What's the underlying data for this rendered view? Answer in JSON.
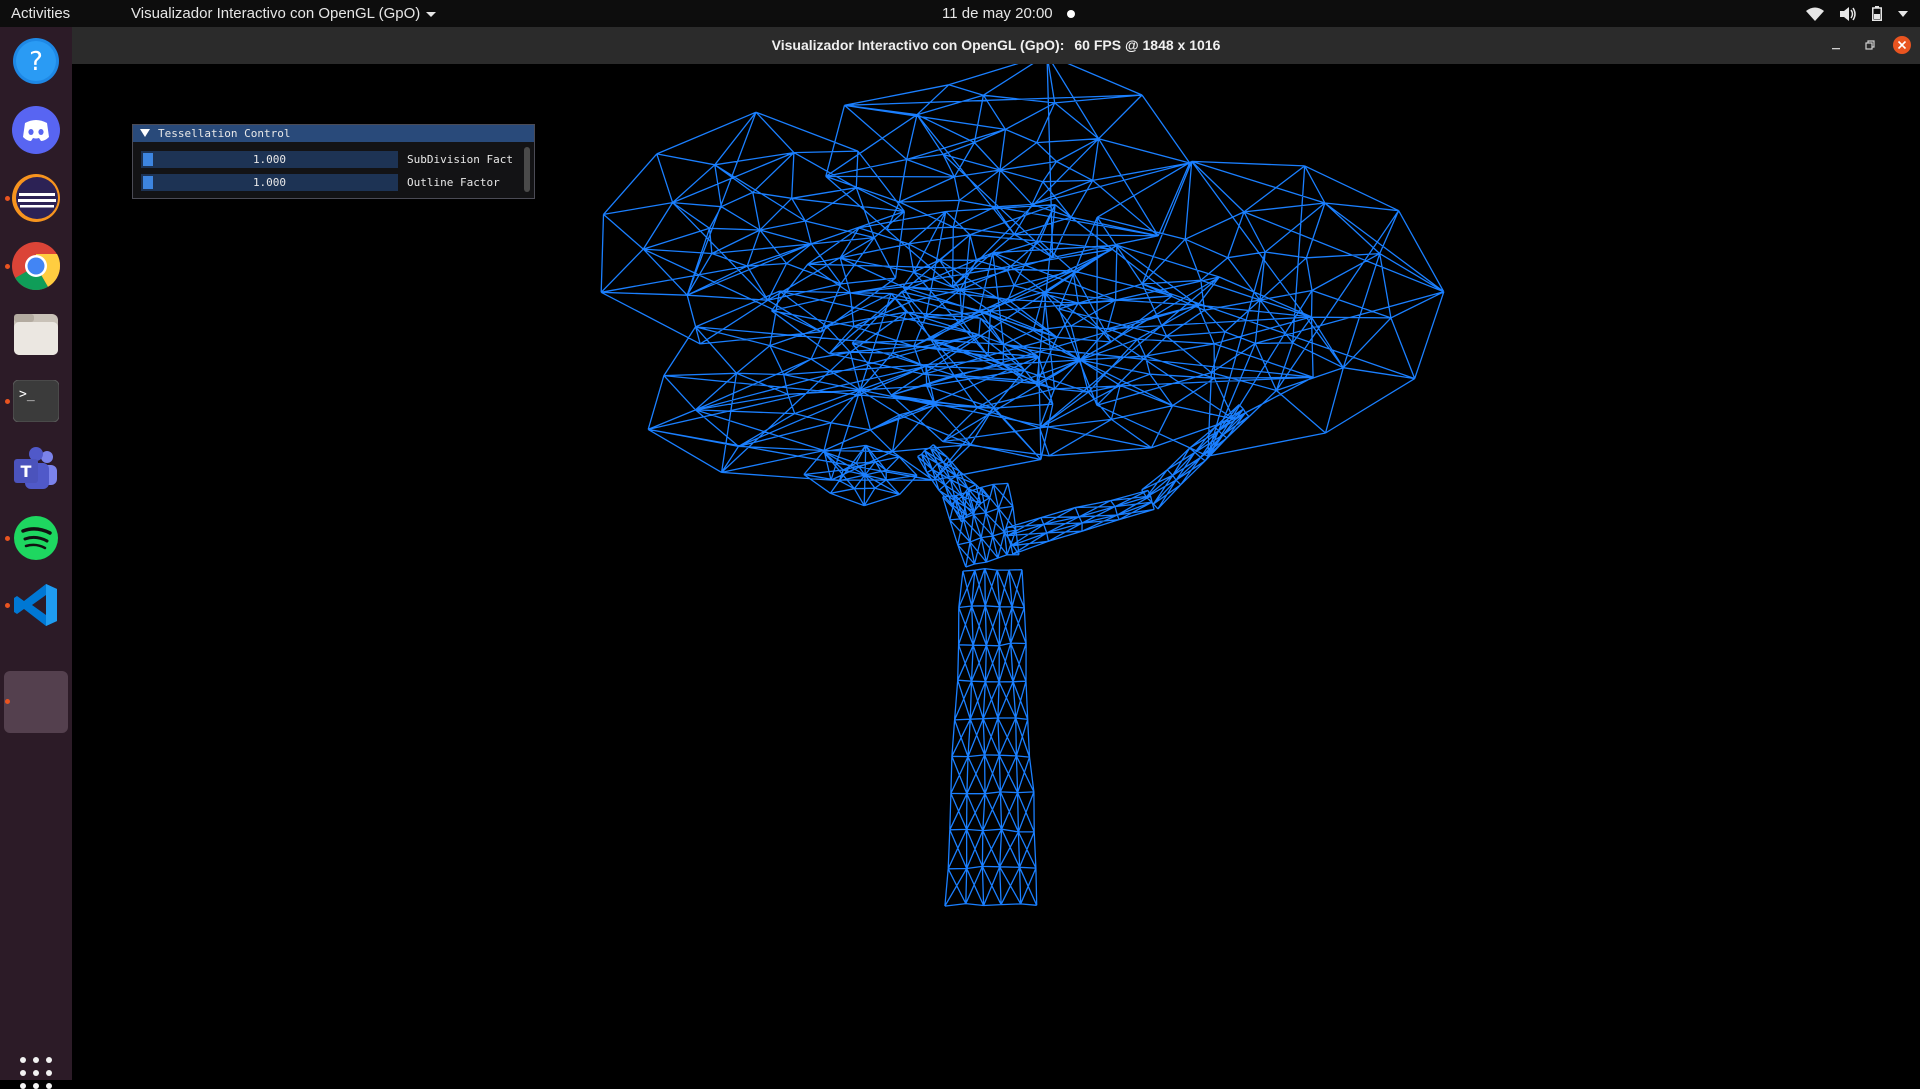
{
  "topbar": {
    "activities": "Activities",
    "app_menu": "Visualizador Interactivo con OpenGL (GpO)",
    "clock": "11 de may  20:00"
  },
  "dock": {
    "items": [
      "help-icon",
      "discord-icon",
      "eclipse-icon",
      "chrome-icon",
      "files-icon",
      "terminal-icon",
      "teams-icon",
      "spotify-icon",
      "vscode-icon"
    ],
    "show_apps": "apps-grid-icon"
  },
  "window": {
    "title_app": "Visualizador Interactivo con OpenGL (GpO):",
    "title_stats": "60 FPS @ 1848 x 1016"
  },
  "imgui": {
    "header": "Tessellation Control",
    "sliders": [
      {
        "value": "1.000",
        "label": "SubDivision Fact"
      },
      {
        "value": "1.000",
        "label": "Outline Factor"
      }
    ]
  },
  "colors": {
    "wireframe": "#1a7fff",
    "accent": "#e95420"
  }
}
